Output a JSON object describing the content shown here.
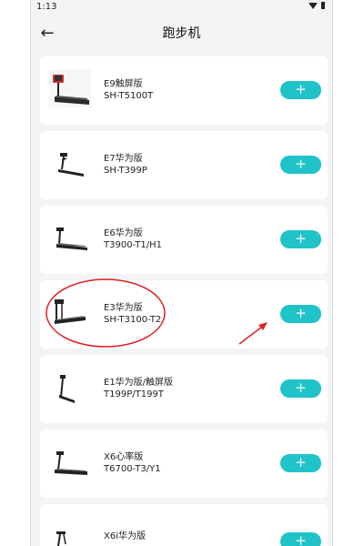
{
  "status_bar": {
    "time": "1:13"
  },
  "header": {
    "back_icon": "arrow-left-icon",
    "title": "跑步机"
  },
  "items": [
    {
      "name": "E9触屏版",
      "model": "SH-T5100T",
      "add_label": "+"
    },
    {
      "name": "E7华为版",
      "model": "SH-T399P",
      "add_label": "+"
    },
    {
      "name": "E6华为版",
      "model": "T3900-T1/H1",
      "add_label": "+"
    },
    {
      "name": "E3华为版",
      "model": "SH-T3100-T2",
      "add_label": "+"
    },
    {
      "name": "E1华为版/触屏版",
      "model": "T199P/T199T",
      "add_label": "+"
    },
    {
      "name": "X6心率版",
      "model": "T6700-T3/Y1",
      "add_label": "+"
    },
    {
      "name": "X6i华为版",
      "model": "",
      "add_label": "+"
    }
  ],
  "colors": {
    "accent": "#20c3c7",
    "annotation": "#e02020",
    "background": "#f3f4f6"
  }
}
